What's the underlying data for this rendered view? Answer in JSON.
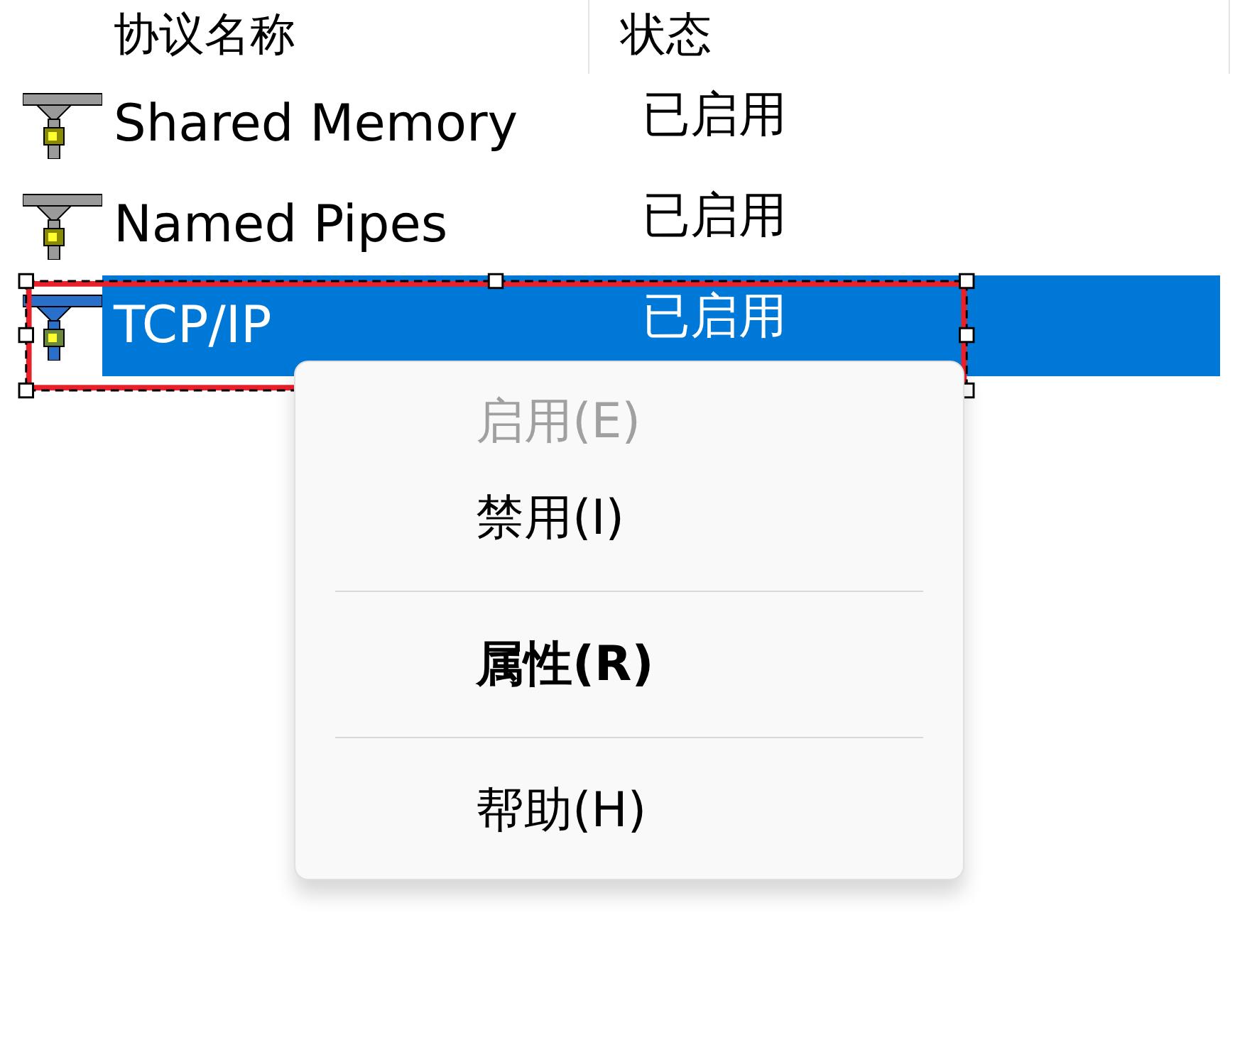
{
  "table": {
    "columns": [
      "协议名称",
      "状态"
    ],
    "rows": [
      {
        "name": "Shared Memory",
        "status": "已启用",
        "selected": false
      },
      {
        "name": "Named Pipes",
        "status": "已启用",
        "selected": false
      },
      {
        "name": "TCP/IP",
        "status": "已启用",
        "selected": true
      }
    ]
  },
  "context_menu": {
    "items": [
      {
        "kind": "item",
        "label": "启用(E)",
        "disabled": true,
        "bold": false
      },
      {
        "kind": "item",
        "label": "禁用(I)",
        "disabled": false,
        "bold": false
      },
      {
        "kind": "separator"
      },
      {
        "kind": "item",
        "label": "属性(R)",
        "disabled": false,
        "bold": true
      },
      {
        "kind": "separator"
      },
      {
        "kind": "item",
        "label": "帮助(H)",
        "disabled": false,
        "bold": false
      }
    ]
  }
}
